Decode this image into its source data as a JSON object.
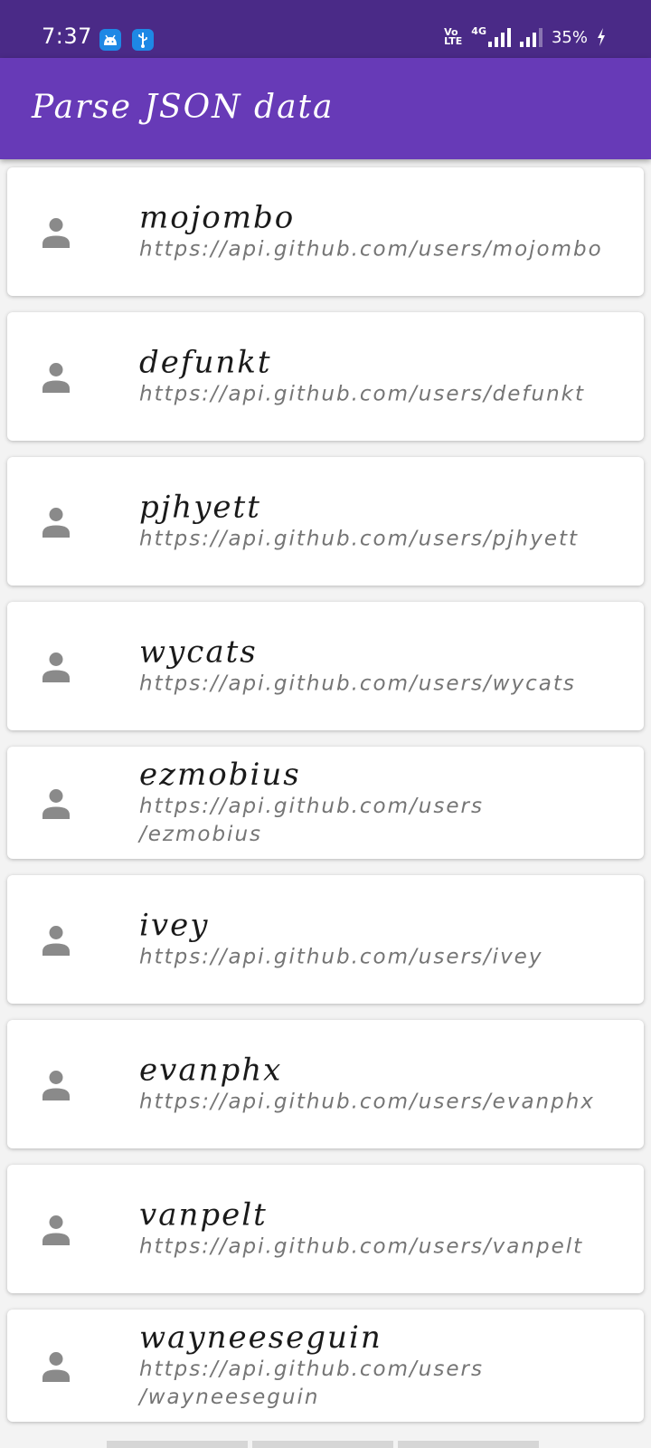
{
  "status_bar": {
    "time": "7:37",
    "notification_icons": [
      "android-icon",
      "usb-icon"
    ],
    "volte_label": "Vo\nLTE",
    "network_label": "4G",
    "battery": "35%"
  },
  "app_bar": {
    "title": "Parse JSON data"
  },
  "users": [
    {
      "login": "mojombo",
      "url": "https://api.github.com/users/mojombo"
    },
    {
      "login": "defunkt",
      "url": "https://api.github.com/users/defunkt"
    },
    {
      "login": "pjhyett",
      "url": "https://api.github.com/users/pjhyett"
    },
    {
      "login": "wycats",
      "url": "https://api.github.com/users/wycats"
    },
    {
      "login": "ezmobius",
      "url": "https://api.github.com/users\n/ezmobius"
    },
    {
      "login": "ivey",
      "url": "https://api.github.com/users/ivey"
    },
    {
      "login": "evanphx",
      "url": "https://api.github.com/users/evanphx"
    },
    {
      "login": "vanpelt",
      "url": "https://api.github.com/users/vanpelt"
    },
    {
      "login": "wayneeseguin",
      "url": "https://api.github.com/users\n/wayneeseguin"
    }
  ],
  "colors": {
    "status_bar": "#4a2a87",
    "app_bar": "#673ab7",
    "icon": "#8a8a8a"
  }
}
